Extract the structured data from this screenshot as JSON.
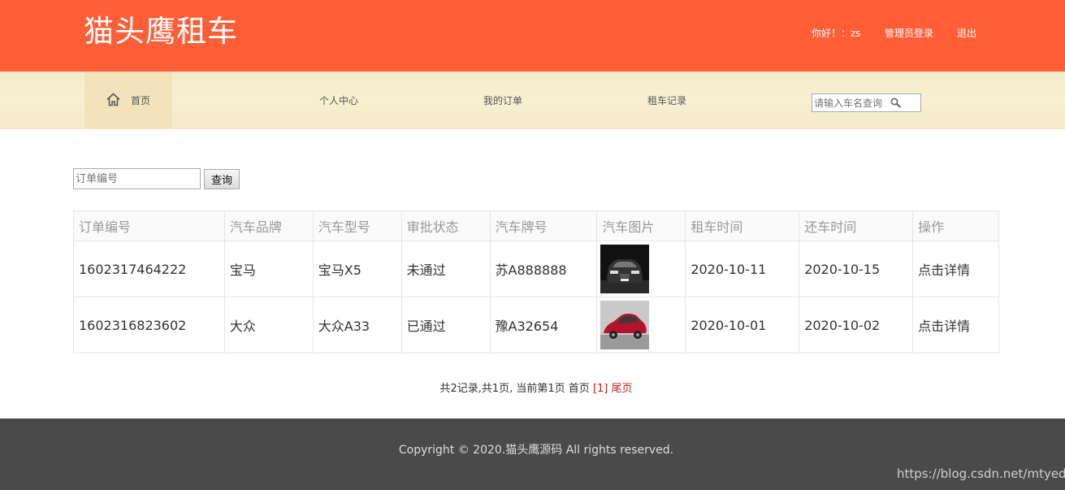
{
  "header": {
    "logo": "猫头鹰租车",
    "greeting": "你好！：zs",
    "admin_login": "管理员登录",
    "logout": "退出"
  },
  "nav": {
    "items": [
      "首页",
      "个人中心",
      "我的订单",
      "租车记录"
    ],
    "search_placeholder": "请输入车名查询"
  },
  "order_search": {
    "placeholder": "订单编号",
    "button": "查询"
  },
  "table": {
    "columns": [
      "订单编号",
      "汽车品牌",
      "汽车型号",
      "审批状态",
      "汽车牌号",
      "汽车图片",
      "租车时间",
      "还车时间",
      "操作"
    ],
    "rows": [
      {
        "order_no": "1602317464222",
        "brand": "宝马",
        "model": "宝马X5",
        "status": "未通过",
        "plate": "苏A888888",
        "image": "black-car-image",
        "rent_date": "2020-10-11",
        "return_date": "2020-10-15",
        "action": "点击详情"
      },
      {
        "order_no": "1602316823602",
        "brand": "大众",
        "model": "大众A33",
        "status": "已通过",
        "plate": "豫A32654",
        "image": "red-car-image",
        "rent_date": "2020-10-01",
        "return_date": "2020-10-02",
        "action": "点击详情"
      }
    ]
  },
  "pager": {
    "summary": "共2记录,共1页, 当前第1页 首页",
    "current": "[1]",
    "last": "尾页"
  },
  "footer": {
    "copyright": "Copyright © 2020.猫头鹰源码 All rights reserved.",
    "watermark": "https://blog.csdn.net/mtyedu"
  },
  "colors": {
    "header_bg": "#ff5e36",
    "nav_bg": "#f6eccb",
    "footer_bg": "#4a4a4a",
    "pager_link": "#c81e1e"
  }
}
